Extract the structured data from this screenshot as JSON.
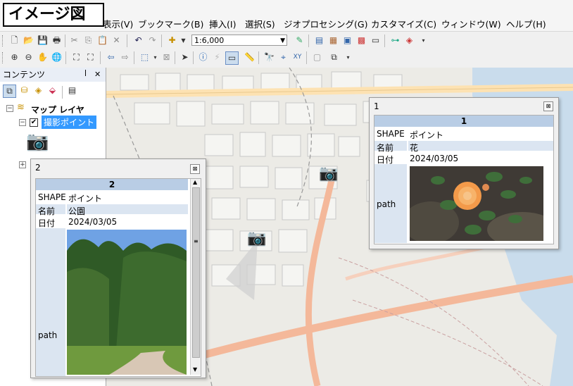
{
  "overlay": {
    "label": "イメージ図"
  },
  "menu": [
    "表示(V)",
    "ブックマーク(B)",
    "挿入(I)",
    "選択(S)",
    "ジオプロセシング(G)",
    "カスタマイズ(C)",
    "ウィンドウ(W)",
    "ヘルプ(H)"
  ],
  "toolbar": {
    "scale_value": "1:6,000"
  },
  "toc": {
    "title": "コンテンツ",
    "pin": "ꟾ",
    "close": "✕",
    "root_layer": "マップ レイヤ",
    "layer": "撮影ポイント"
  },
  "popup1": {
    "window_title": "1",
    "header": "1",
    "rows": [
      {
        "label": "SHAPE",
        "value": "ポイント"
      },
      {
        "label": "名前",
        "value": "花"
      },
      {
        "label": "日付",
        "value": "2024/03/05"
      }
    ],
    "path_label": "path"
  },
  "popup2": {
    "window_title": "2",
    "header": "2",
    "rows": [
      {
        "label": "SHAPE",
        "value": "ポイント"
      },
      {
        "label": "名前",
        "value": "公園"
      },
      {
        "label": "日付",
        "value": "2024/03/05"
      }
    ],
    "path_label": "path"
  },
  "colors": {
    "accent": "#b9cde5",
    "stripe": "#dbe5f1",
    "road_major": "#f4b89a",
    "road_main": "#fde2b2",
    "water": "#c9dcec"
  }
}
